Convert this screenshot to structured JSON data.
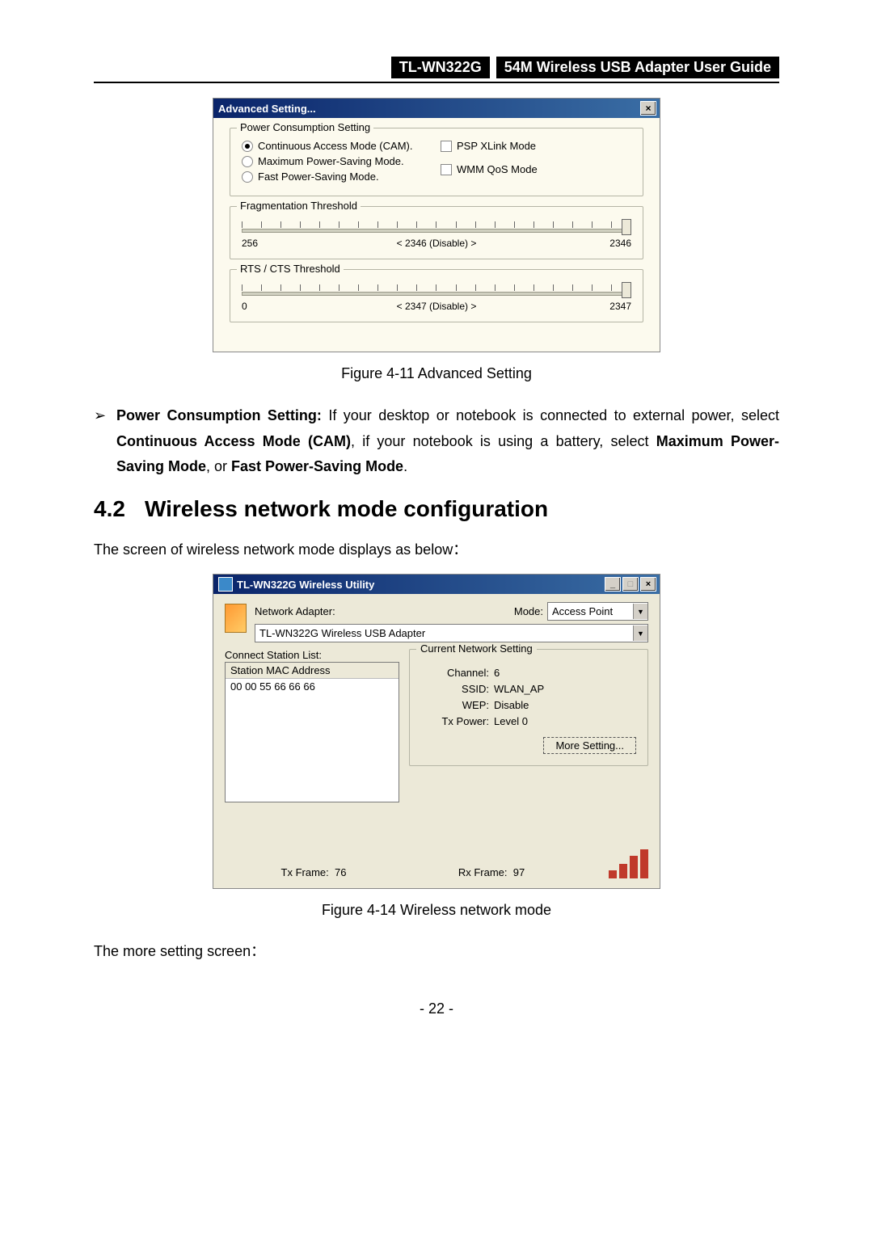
{
  "header": {
    "model": "TL-WN322G",
    "title": "54M Wireless USB Adapter User Guide"
  },
  "dialog1": {
    "title": "Advanced Setting...",
    "close_icon_name": "close-icon",
    "power_group_legend": "Power Consumption Setting",
    "radios": {
      "cam": "Continuous Access Mode (CAM).",
      "maxps": "Maximum Power-Saving Mode.",
      "fastps": "Fast Power-Saving Mode."
    },
    "selected_radio": "cam",
    "checks": {
      "psp": "PSP XLink Mode",
      "wmm": "WMM QoS Mode"
    },
    "frag_group_legend": "Fragmentation Threshold",
    "frag": {
      "min": "256",
      "max": "2346",
      "current_label": "< 2346 (Disable) >"
    },
    "rts_group_legend": "RTS / CTS Threshold",
    "rts": {
      "min": "0",
      "max": "2347",
      "current_label": "< 2347 (Disable) >"
    }
  },
  "figure1_caption": "Figure 4-11 Advanced Setting",
  "bullet1": {
    "glyph": "➢",
    "lead_bold": "Power Consumption Setting:",
    "rest1": " If your desktop or notebook is connected to external power, select ",
    "bold2": "Continuous Access Mode (CAM)",
    "rest2": ", if your notebook is using a battery, select ",
    "bold3": "Maximum Power-Saving Mode",
    "rest3": ", or ",
    "bold4": "Fast Power-Saving Mode",
    "rest4": "."
  },
  "section": {
    "number": "4.2",
    "title": "Wireless network mode configuration"
  },
  "para1": "The screen of wireless network mode displays as below：",
  "dialog2": {
    "title": "TL-WN322G Wireless Utility",
    "network_adapter_label": "Network Adapter:",
    "mode_label": "Mode:",
    "mode_value": "Access Point",
    "adapter_value": "TL-WN322G Wireless USB Adapter",
    "connect_list_label": "Connect Station List:",
    "station_header": "Station MAC Address",
    "station_item": "00 00 55 66 66 66",
    "current_net_legend": "Current Network Setting",
    "channel_label": "Channel:",
    "channel_value": "6",
    "ssid_label": "SSID:",
    "ssid_value": "WLAN_AP",
    "wep_label": "WEP:",
    "wep_value": "Disable",
    "txpower_label": "Tx Power:",
    "txpower_value": "Level 0",
    "more_btn": "More Setting...",
    "tx_frame_label": "Tx Frame:",
    "tx_frame_value": "76",
    "rx_frame_label": "Rx Frame:",
    "rx_frame_value": "97"
  },
  "figure2_caption": "Figure 4-14 Wireless network mode",
  "para2": "The more setting screen：",
  "page_number": "- 22 -"
}
